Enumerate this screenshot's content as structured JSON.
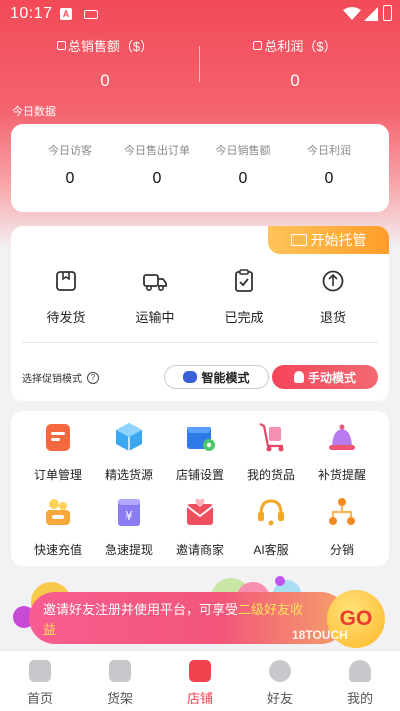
{
  "status_bar": {
    "time": "10:17",
    "notif_letter": "A"
  },
  "totals": {
    "sales_label": "总销售额（$）",
    "sales_value": "0",
    "profit_label": "总利润（$）",
    "profit_value": "0"
  },
  "today": {
    "section_label": "今日数据",
    "items": [
      {
        "label": "今日访客",
        "value": "0"
      },
      {
        "label": "今日售出订单",
        "value": "0"
      },
      {
        "label": "今日销售额",
        "value": "0"
      },
      {
        "label": "今日利润",
        "value": "0"
      }
    ]
  },
  "orders": {
    "hosting_button": "开始托管",
    "statuses": [
      {
        "label": "待发货",
        "icon": "package-icon"
      },
      {
        "label": "运输中",
        "icon": "truck-icon"
      },
      {
        "label": "已完成",
        "icon": "clipboard-check-icon"
      },
      {
        "label": "退货",
        "icon": "return-icon"
      }
    ],
    "promo_mode_label": "选择促销模式",
    "help_icon_text": "?",
    "smart_mode": "智能模式",
    "manual_mode": "手动模式"
  },
  "features": [
    {
      "label": "订单管理",
      "icon": "order-manage-icon"
    },
    {
      "label": "精选货源",
      "icon": "cube-icon"
    },
    {
      "label": "店铺设置",
      "icon": "store-settings-icon"
    },
    {
      "label": "我的货品",
      "icon": "cart-goods-icon"
    },
    {
      "label": "补货提醒",
      "icon": "bell-icon"
    },
    {
      "label": "快速充值",
      "icon": "coin-box-icon"
    },
    {
      "label": "急速提现",
      "icon": "withdraw-icon"
    },
    {
      "label": "邀请商家",
      "icon": "invite-envelope-icon"
    },
    {
      "label": "AI客服",
      "icon": "headset-icon"
    },
    {
      "label": "分销",
      "icon": "distribution-icon"
    }
  ],
  "banner": {
    "text_before": "邀请好友注册并使用平台，可享受",
    "text_highlight": "二级好友收益",
    "go_label": "GO",
    "watermark": "18TOUCH"
  },
  "tabs": [
    {
      "label": "首页",
      "icon": "home-icon",
      "active": false
    },
    {
      "label": "货架",
      "icon": "bag-icon",
      "active": false
    },
    {
      "label": "店铺",
      "icon": "store-icon",
      "active": true
    },
    {
      "label": "好友",
      "icon": "friends-icon",
      "active": false
    },
    {
      "label": "我的",
      "icon": "profile-icon",
      "active": false
    }
  ],
  "colors": {
    "brand_red": "#f0414f",
    "hosting_orange": "#ff9d2a",
    "banner_highlight": "#ffe35b"
  }
}
